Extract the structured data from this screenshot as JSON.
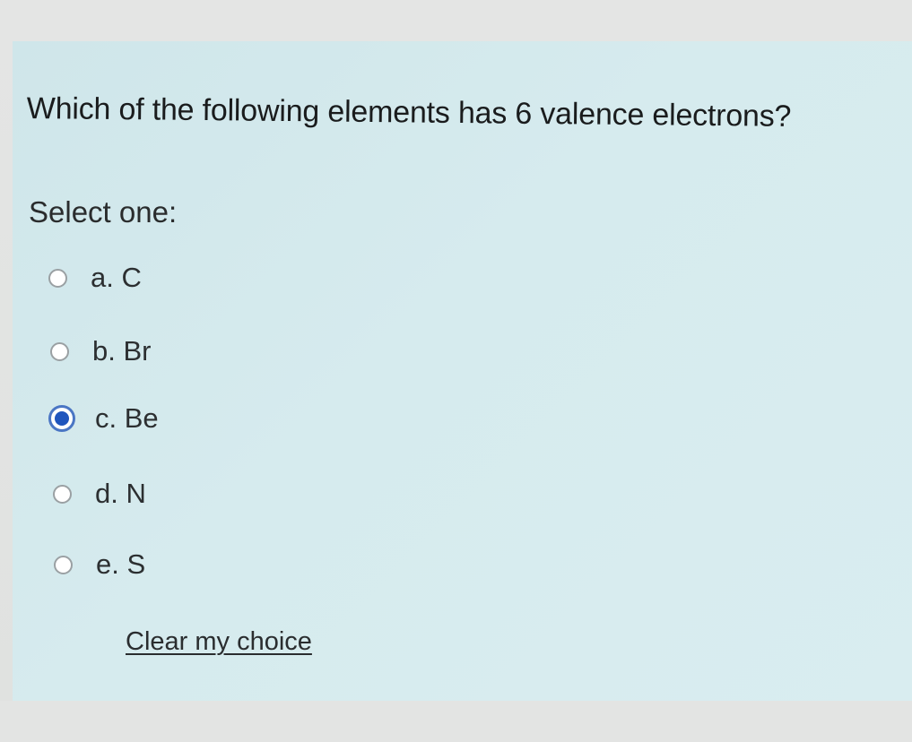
{
  "question": {
    "text": "Which of the following elements has 6 valence electrons?",
    "prompt": "Select one:"
  },
  "options": [
    {
      "label": "a. C",
      "selected": false
    },
    {
      "label": "b. Br",
      "selected": false
    },
    {
      "label": "c. Be",
      "selected": true
    },
    {
      "label": "d. N",
      "selected": false
    },
    {
      "label": "e. S",
      "selected": false
    }
  ],
  "clear_link": "Clear my choice",
  "colors": {
    "panel_background": "#d6ebee",
    "selected_radio": "#1f55bd"
  }
}
